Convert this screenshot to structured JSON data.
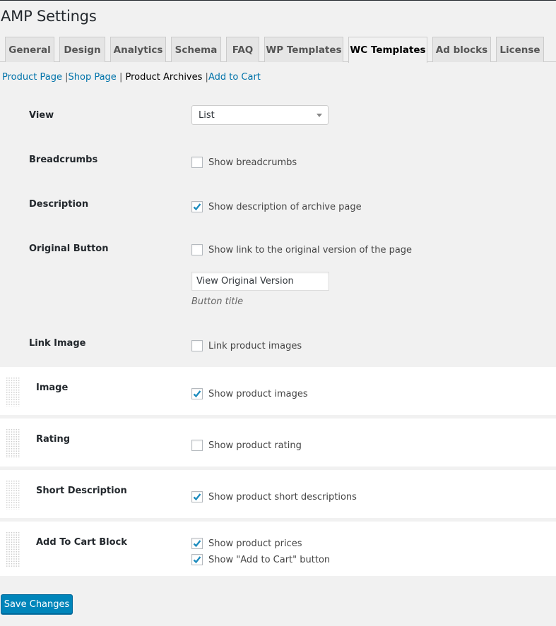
{
  "page": {
    "title": "AMP Settings"
  },
  "tabs": [
    {
      "label": "General",
      "active": false
    },
    {
      "label": "Design",
      "active": false
    },
    {
      "label": "Analytics",
      "active": false
    },
    {
      "label": "Schema",
      "active": false
    },
    {
      "label": "FAQ",
      "active": false
    },
    {
      "label": "WP Templates",
      "active": false
    },
    {
      "label": "WC Templates",
      "active": true
    },
    {
      "label": "Ad blocks",
      "active": false
    },
    {
      "label": "License",
      "active": false
    }
  ],
  "subnav": {
    "items": [
      {
        "label": "Product Page",
        "current": false
      },
      {
        "label": "Shop Page",
        "current": false
      },
      {
        "label": "Product Archives",
        "current": true
      },
      {
        "label": "Add to Cart",
        "current": false
      }
    ],
    "separator": "|"
  },
  "settings": {
    "view": {
      "label": "View",
      "value": "List"
    },
    "breadcrumbs": {
      "label": "Breadcrumbs",
      "option": "Show breadcrumbs",
      "checked": false
    },
    "description": {
      "label": "Description",
      "option": "Show description of archive page",
      "checked": true
    },
    "original_button": {
      "label": "Original Button",
      "option": "Show link to the original version of the page",
      "checked": false,
      "input_value": "View Original Version",
      "hint": "Button title"
    },
    "link_image": {
      "label": "Link Image",
      "option": "Link product images",
      "checked": false
    }
  },
  "blocks": {
    "image": {
      "label": "Image",
      "option": "Show product images",
      "checked": true
    },
    "rating": {
      "label": "Rating",
      "option": "Show product rating",
      "checked": false
    },
    "short_description": {
      "label": "Short Description",
      "option": "Show product short descriptions",
      "checked": true
    },
    "add_to_cart": {
      "label": "Add To Cart Block",
      "options": [
        {
          "label": "Show product prices",
          "checked": true
        },
        {
          "label": "Show \"Add to Cart\" button",
          "checked": true
        }
      ]
    }
  },
  "actions": {
    "save_label": "Save Changes"
  },
  "colors": {
    "accent": "#0085ba",
    "link": "#0073aa",
    "check": "#1e8cbe",
    "background": "#f1f1f1"
  }
}
